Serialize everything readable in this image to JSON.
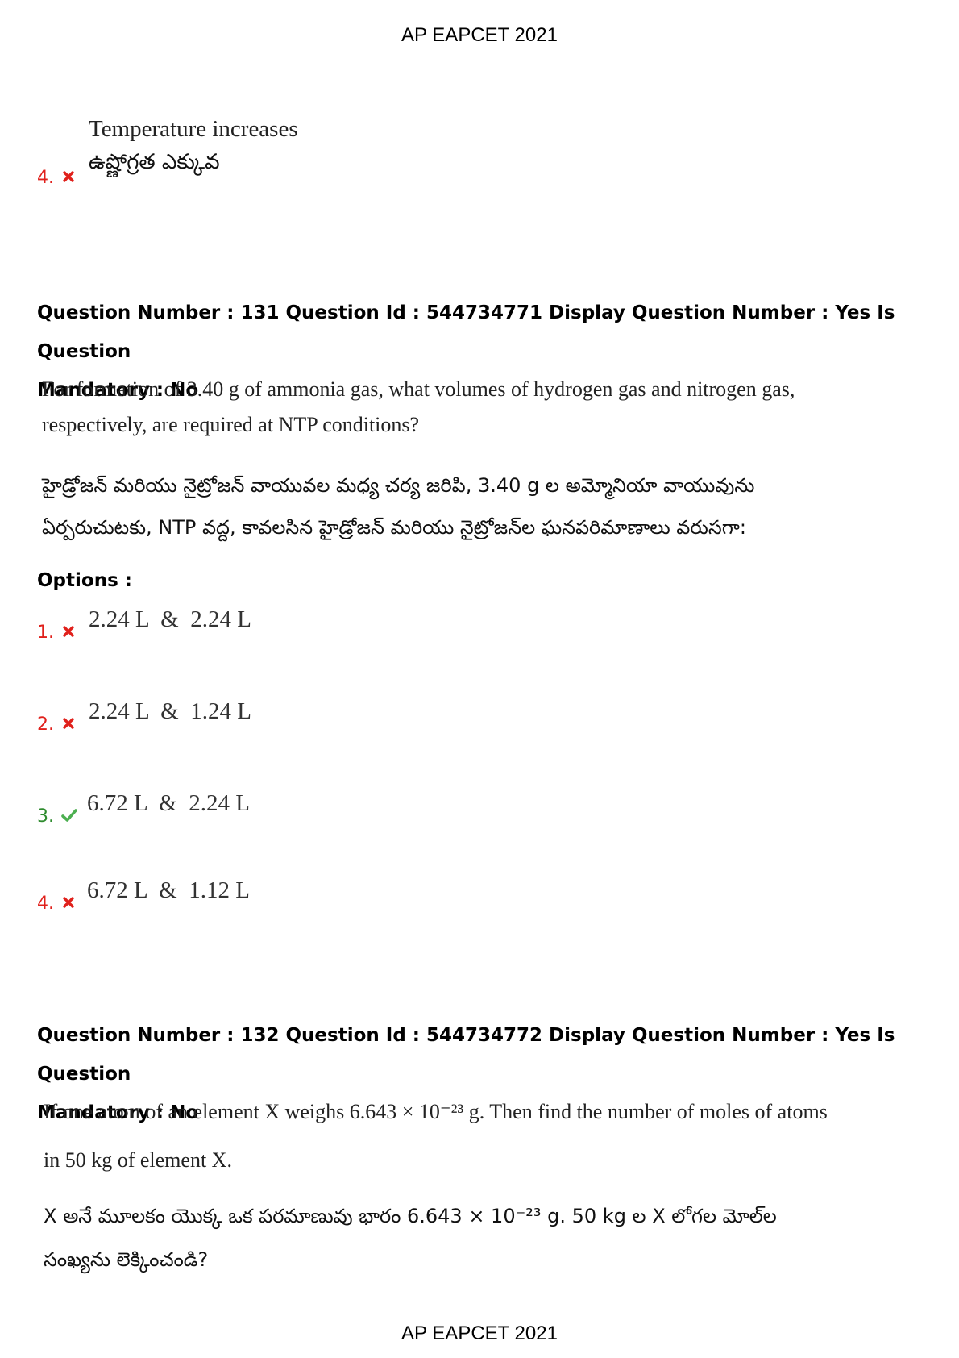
{
  "header": {
    "title": "AP EAPCET 2021"
  },
  "footer": {
    "title": "AP EAPCET 2021"
  },
  "prev_option": {
    "number": "4.",
    "status": "wrong",
    "english": "Temperature increases",
    "telugu": "ఉష్ణోగ్రత ఎక్కువ"
  },
  "q131": {
    "title_line1": "Question Number : 131 Question Id : 544734771 Display Question Number : Yes Is Question",
    "title_line2": "Mandatory : No",
    "english_line1": "For formation of 3.40 g of ammonia gas, what volumes of hydrogen gas and nitrogen gas,",
    "english_line2": "respectively, are required at NTP conditions?",
    "telugu_line1": "హైడ్రోజన్ మరియు నైట్రోజన్ వాయువల మధ్య చర్య జరిపి, 3.40 g ల అమ్మోనియా వాయువును",
    "telugu_line2": "ఏర్పరుచుటకు, NTP వద్ద, కావలసిన హైడ్రోజన్ మరియు నైట్రోజన్‌ల ఘనపరిమాణాలు వరుసగా:",
    "options_label": "Options :",
    "options": [
      {
        "number": "1.",
        "status": "wrong",
        "text": "2.24 L  &  2.24 L"
      },
      {
        "number": "2.",
        "status": "wrong",
        "text": "2.24 L  &  1.24 L"
      },
      {
        "number": "3.",
        "status": "correct",
        "text": "6.72 L  &  2.24 L"
      },
      {
        "number": "4.",
        "status": "wrong",
        "text": "6.72 L  &  1.12 L"
      }
    ]
  },
  "q132": {
    "title_line1": "Question Number : 132 Question Id : 544734772 Display Question Number : Yes Is Question",
    "title_line2": "Mandatory : No",
    "english_line1": "If one atom of an element X weighs 6.643 × 10⁻²³ g. Then find the number of moles of atoms",
    "english_line2": "in 50 kg of element X.",
    "telugu_line1": "X అనే మూలకం యొక్క ఒక పరమాణువు భారం 6.643 × 10⁻²³ g. 50 kg ల X లోగల మోల్‌ల",
    "telugu_line2": "సంఖ్యను లెక్కించండి?"
  },
  "colors": {
    "wrong": "#e0201b",
    "correct": "#2e8b2e"
  },
  "icons": {
    "wrong": "cross-icon",
    "correct": "check-icon"
  }
}
